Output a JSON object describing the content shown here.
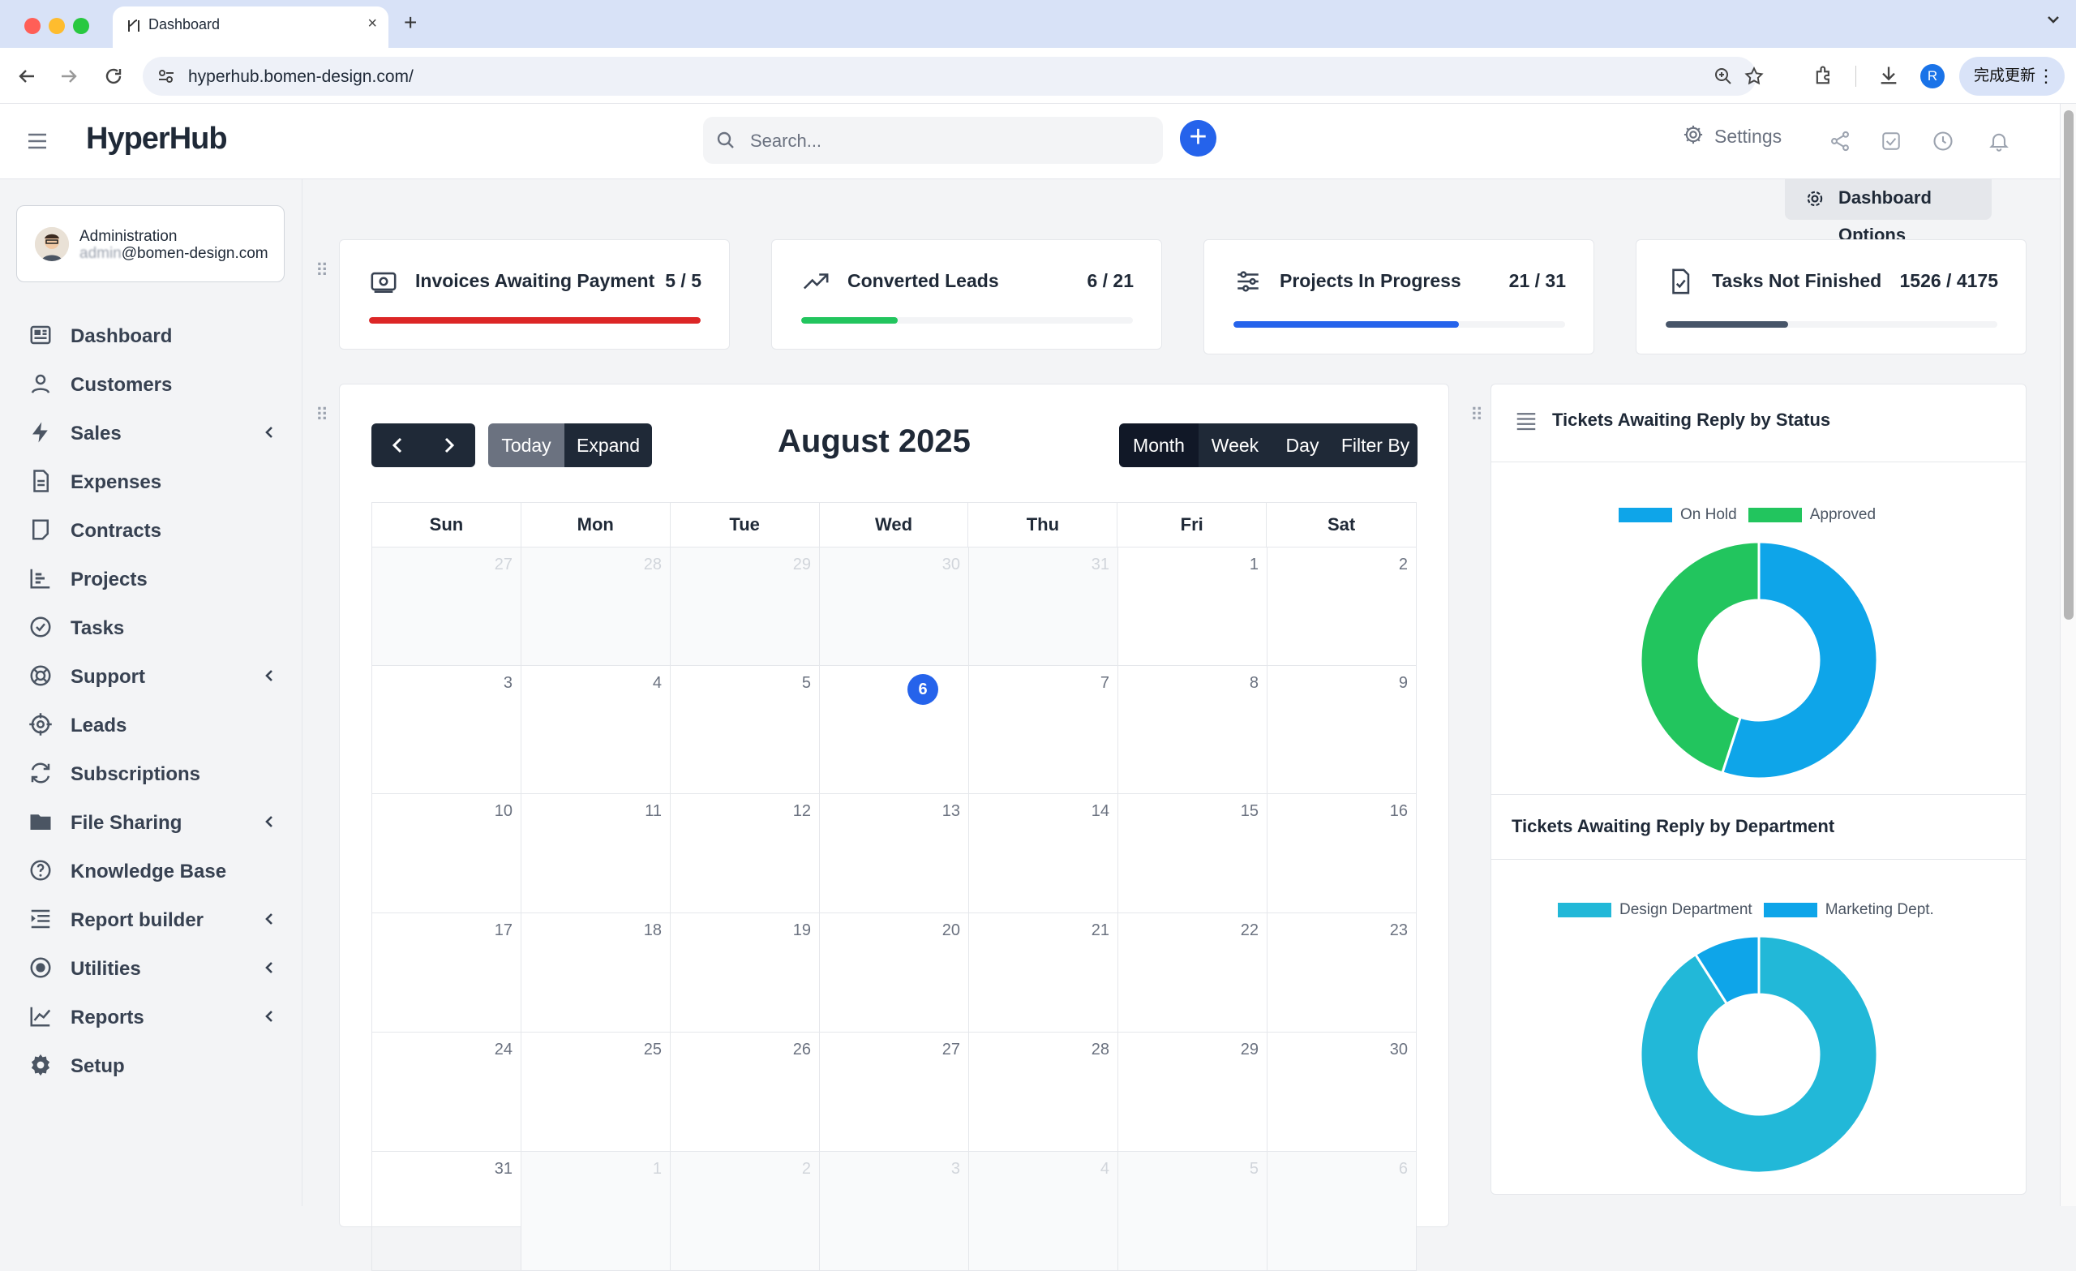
{
  "browser": {
    "tab_title": "Dashboard",
    "url": "hyperhub.bomen-design.com/",
    "update_label": "完成更新",
    "profile_initial": "R"
  },
  "app": {
    "logo": "HyperHub",
    "search_placeholder": "Search...",
    "settings_label": "Settings",
    "dashboard_options": "Dashboard Options"
  },
  "user": {
    "role": "Administration",
    "email_hidden": "admin",
    "email_domain": "@bomen-design.com"
  },
  "nav": [
    {
      "label": "Dashboard",
      "icon": "dashboard-icon",
      "chevron": false
    },
    {
      "label": "Customers",
      "icon": "user-icon",
      "chevron": false
    },
    {
      "label": "Sales",
      "icon": "bolt-icon",
      "chevron": true
    },
    {
      "label": "Expenses",
      "icon": "file-icon",
      "chevron": false
    },
    {
      "label": "Contracts",
      "icon": "document-icon",
      "chevron": false
    },
    {
      "label": "Projects",
      "icon": "chart-bar-icon",
      "chevron": false
    },
    {
      "label": "Tasks",
      "icon": "check-circle-icon",
      "chevron": false
    },
    {
      "label": "Support",
      "icon": "lifebuoy-icon",
      "chevron": true
    },
    {
      "label": "Leads",
      "icon": "crosshair-icon",
      "chevron": false
    },
    {
      "label": "Subscriptions",
      "icon": "refresh-icon",
      "chevron": false
    },
    {
      "label": "File Sharing",
      "icon": "folder-icon",
      "chevron": true
    },
    {
      "label": "Knowledge Base",
      "icon": "question-icon",
      "chevron": false
    },
    {
      "label": "Report builder",
      "icon": "list-icon",
      "chevron": true
    },
    {
      "label": "Utilities",
      "icon": "radio-icon",
      "chevron": true
    },
    {
      "label": "Reports",
      "icon": "line-chart-icon",
      "chevron": true
    },
    {
      "label": "Setup",
      "icon": "gear-icon",
      "chevron": false
    }
  ],
  "stats": [
    {
      "title": "Invoices Awaiting Payment",
      "value": "5 / 5",
      "progress": 1.0,
      "color": "#dc2626",
      "icon": "money-icon"
    },
    {
      "title": "Converted Leads",
      "value": "6 / 21",
      "progress": 0.29,
      "color": "#22c55e",
      "icon": "trend-up-icon"
    },
    {
      "title": "Projects In Progress",
      "value": "21 / 31",
      "progress": 0.68,
      "color": "#2563eb",
      "icon": "sliders-icon"
    },
    {
      "title": "Tasks Not Finished",
      "value": "1526 / 4175",
      "progress": 0.37,
      "color": "#475569",
      "icon": "file-check-icon"
    }
  ],
  "calendar": {
    "title": "August 2025",
    "buttons": {
      "today": "Today",
      "expand": "Expand",
      "month": "Month",
      "week": "Week",
      "day": "Day",
      "filter": "Filter By"
    },
    "weekdays": [
      "Sun",
      "Mon",
      "Tue",
      "Wed",
      "Thu",
      "Fri",
      "Sat"
    ],
    "weeks": [
      [
        [
          "27",
          1
        ],
        [
          "28",
          1
        ],
        [
          "29",
          1
        ],
        [
          "30",
          1
        ],
        [
          "31",
          1
        ],
        [
          "1",
          0
        ],
        [
          "2",
          0
        ]
      ],
      [
        [
          "3",
          0
        ],
        [
          "4",
          0
        ],
        [
          "5",
          0
        ],
        [
          "6",
          2
        ],
        [
          "7",
          0
        ],
        [
          "8",
          0
        ],
        [
          "9",
          0
        ]
      ],
      [
        [
          "10",
          0
        ],
        [
          "11",
          0
        ],
        [
          "12",
          0
        ],
        [
          "13",
          0
        ],
        [
          "14",
          0
        ],
        [
          "15",
          0
        ],
        [
          "16",
          0
        ]
      ],
      [
        [
          "17",
          0
        ],
        [
          "18",
          0
        ],
        [
          "19",
          0
        ],
        [
          "20",
          0
        ],
        [
          "21",
          0
        ],
        [
          "22",
          0
        ],
        [
          "23",
          0
        ]
      ],
      [
        [
          "24",
          0
        ],
        [
          "25",
          0
        ],
        [
          "26",
          0
        ],
        [
          "27",
          0
        ],
        [
          "28",
          0
        ],
        [
          "29",
          0
        ],
        [
          "30",
          0
        ]
      ],
      [
        [
          "31",
          0
        ],
        [
          "1",
          1
        ],
        [
          "2",
          1
        ],
        [
          "3",
          1
        ],
        [
          "4",
          1
        ],
        [
          "5",
          1
        ],
        [
          "6",
          1
        ]
      ]
    ]
  },
  "tickets": {
    "status_title": "Tickets Awaiting Reply by Status",
    "department_title": "Tickets Awaiting Reply by Department"
  },
  "chart_data": [
    {
      "type": "pie",
      "title": "Tickets Awaiting Reply by Status",
      "categories": [
        "On Hold",
        "Approved"
      ],
      "values": [
        55,
        45
      ],
      "colors": [
        "#0ea5e9",
        "#22c55e"
      ],
      "legend": "top"
    },
    {
      "type": "pie",
      "title": "Tickets Awaiting Reply by Department",
      "categories": [
        "Design Department",
        "Marketing Dept."
      ],
      "values": [
        91,
        9
      ],
      "colors": [
        "#22b8d8",
        "#0ea5e9"
      ],
      "legend": "top"
    }
  ]
}
